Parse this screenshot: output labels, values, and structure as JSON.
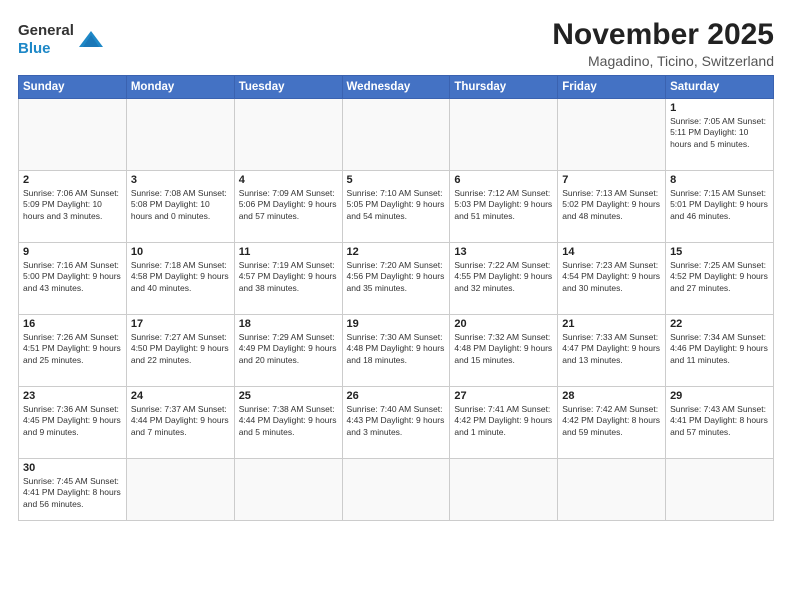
{
  "logo": {
    "text_general": "General",
    "text_blue": "Blue"
  },
  "title": "November 2025",
  "subtitle": "Magadino, Ticino, Switzerland",
  "weekdays": [
    "Sunday",
    "Monday",
    "Tuesday",
    "Wednesday",
    "Thursday",
    "Friday",
    "Saturday"
  ],
  "weeks": [
    [
      {
        "day": "",
        "info": ""
      },
      {
        "day": "",
        "info": ""
      },
      {
        "day": "",
        "info": ""
      },
      {
        "day": "",
        "info": ""
      },
      {
        "day": "",
        "info": ""
      },
      {
        "day": "",
        "info": ""
      },
      {
        "day": "1",
        "info": "Sunrise: 7:05 AM\nSunset: 5:11 PM\nDaylight: 10 hours and 5 minutes."
      }
    ],
    [
      {
        "day": "2",
        "info": "Sunrise: 7:06 AM\nSunset: 5:09 PM\nDaylight: 10 hours and 3 minutes."
      },
      {
        "day": "3",
        "info": "Sunrise: 7:08 AM\nSunset: 5:08 PM\nDaylight: 10 hours and 0 minutes."
      },
      {
        "day": "4",
        "info": "Sunrise: 7:09 AM\nSunset: 5:06 PM\nDaylight: 9 hours and 57 minutes."
      },
      {
        "day": "5",
        "info": "Sunrise: 7:10 AM\nSunset: 5:05 PM\nDaylight: 9 hours and 54 minutes."
      },
      {
        "day": "6",
        "info": "Sunrise: 7:12 AM\nSunset: 5:03 PM\nDaylight: 9 hours and 51 minutes."
      },
      {
        "day": "7",
        "info": "Sunrise: 7:13 AM\nSunset: 5:02 PM\nDaylight: 9 hours and 48 minutes."
      },
      {
        "day": "8",
        "info": "Sunrise: 7:15 AM\nSunset: 5:01 PM\nDaylight: 9 hours and 46 minutes."
      }
    ],
    [
      {
        "day": "9",
        "info": "Sunrise: 7:16 AM\nSunset: 5:00 PM\nDaylight: 9 hours and 43 minutes."
      },
      {
        "day": "10",
        "info": "Sunrise: 7:18 AM\nSunset: 4:58 PM\nDaylight: 9 hours and 40 minutes."
      },
      {
        "day": "11",
        "info": "Sunrise: 7:19 AM\nSunset: 4:57 PM\nDaylight: 9 hours and 38 minutes."
      },
      {
        "day": "12",
        "info": "Sunrise: 7:20 AM\nSunset: 4:56 PM\nDaylight: 9 hours and 35 minutes."
      },
      {
        "day": "13",
        "info": "Sunrise: 7:22 AM\nSunset: 4:55 PM\nDaylight: 9 hours and 32 minutes."
      },
      {
        "day": "14",
        "info": "Sunrise: 7:23 AM\nSunset: 4:54 PM\nDaylight: 9 hours and 30 minutes."
      },
      {
        "day": "15",
        "info": "Sunrise: 7:25 AM\nSunset: 4:52 PM\nDaylight: 9 hours and 27 minutes."
      }
    ],
    [
      {
        "day": "16",
        "info": "Sunrise: 7:26 AM\nSunset: 4:51 PM\nDaylight: 9 hours and 25 minutes."
      },
      {
        "day": "17",
        "info": "Sunrise: 7:27 AM\nSunset: 4:50 PM\nDaylight: 9 hours and 22 minutes."
      },
      {
        "day": "18",
        "info": "Sunrise: 7:29 AM\nSunset: 4:49 PM\nDaylight: 9 hours and 20 minutes."
      },
      {
        "day": "19",
        "info": "Sunrise: 7:30 AM\nSunset: 4:48 PM\nDaylight: 9 hours and 18 minutes."
      },
      {
        "day": "20",
        "info": "Sunrise: 7:32 AM\nSunset: 4:48 PM\nDaylight: 9 hours and 15 minutes."
      },
      {
        "day": "21",
        "info": "Sunrise: 7:33 AM\nSunset: 4:47 PM\nDaylight: 9 hours and 13 minutes."
      },
      {
        "day": "22",
        "info": "Sunrise: 7:34 AM\nSunset: 4:46 PM\nDaylight: 9 hours and 11 minutes."
      }
    ],
    [
      {
        "day": "23",
        "info": "Sunrise: 7:36 AM\nSunset: 4:45 PM\nDaylight: 9 hours and 9 minutes."
      },
      {
        "day": "24",
        "info": "Sunrise: 7:37 AM\nSunset: 4:44 PM\nDaylight: 9 hours and 7 minutes."
      },
      {
        "day": "25",
        "info": "Sunrise: 7:38 AM\nSunset: 4:44 PM\nDaylight: 9 hours and 5 minutes."
      },
      {
        "day": "26",
        "info": "Sunrise: 7:40 AM\nSunset: 4:43 PM\nDaylight: 9 hours and 3 minutes."
      },
      {
        "day": "27",
        "info": "Sunrise: 7:41 AM\nSunset: 4:42 PM\nDaylight: 9 hours and 1 minute."
      },
      {
        "day": "28",
        "info": "Sunrise: 7:42 AM\nSunset: 4:42 PM\nDaylight: 8 hours and 59 minutes."
      },
      {
        "day": "29",
        "info": "Sunrise: 7:43 AM\nSunset: 4:41 PM\nDaylight: 8 hours and 57 minutes."
      }
    ],
    [
      {
        "day": "30",
        "info": "Sunrise: 7:45 AM\nSunset: 4:41 PM\nDaylight: 8 hours and 56 minutes."
      },
      {
        "day": "",
        "info": ""
      },
      {
        "day": "",
        "info": ""
      },
      {
        "day": "",
        "info": ""
      },
      {
        "day": "",
        "info": ""
      },
      {
        "day": "",
        "info": ""
      },
      {
        "day": "",
        "info": ""
      }
    ]
  ]
}
